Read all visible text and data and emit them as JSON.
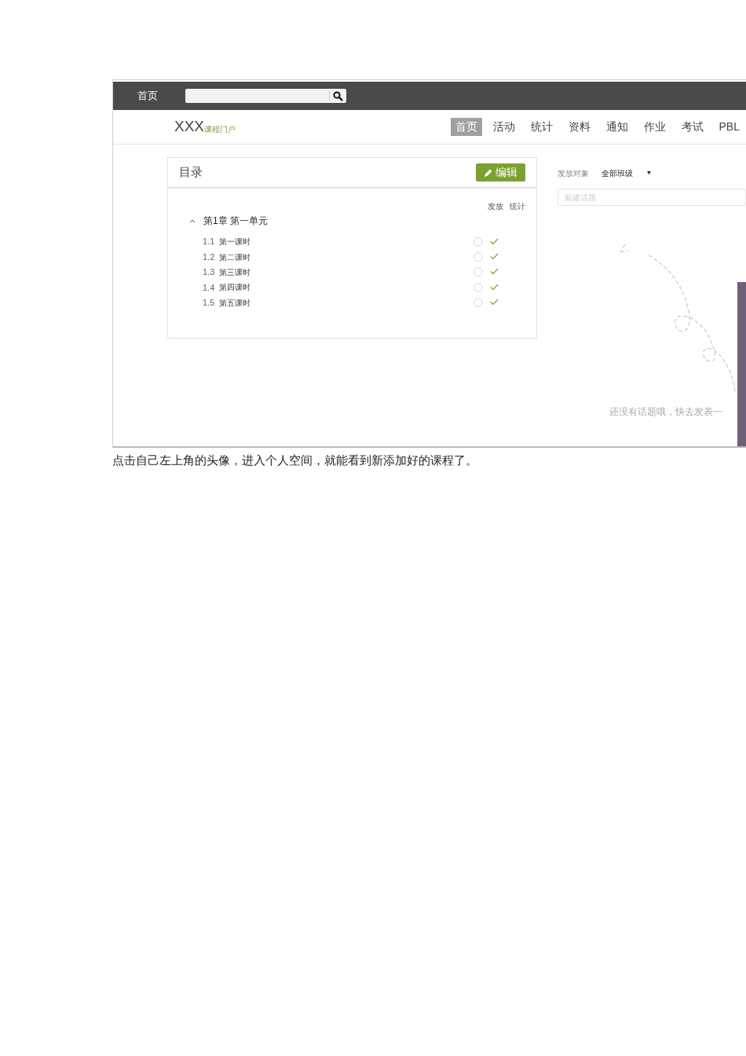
{
  "screenshot": {
    "topbar": {
      "home": "首页"
    },
    "header": {
      "logo": "XXX",
      "logo_sub": "课程门户",
      "nav": [
        {
          "label": "首页",
          "selected": true
        },
        {
          "label": "活动",
          "selected": false
        },
        {
          "label": "统计",
          "selected": false
        },
        {
          "label": "资料",
          "selected": false
        },
        {
          "label": "通知",
          "selected": false
        },
        {
          "label": "作业",
          "selected": false
        },
        {
          "label": "考试",
          "selected": false
        },
        {
          "label": "PBL",
          "selected": false
        }
      ]
    },
    "catalog": {
      "title": "目录",
      "edit_button": "编辑",
      "columns": [
        "发放",
        "统计"
      ],
      "chapters": [
        {
          "title": "第1章 第一单元",
          "expanded": true,
          "children": [
            {
              "number": "1.1",
              "title": "第一课时",
              "released": false,
              "counted": true
            },
            {
              "number": "1.2",
              "title": "第二课时",
              "released": false,
              "counted": true
            },
            {
              "number": "1.3",
              "title": "第三课时",
              "released": false,
              "counted": true
            },
            {
              "number": "1.4",
              "title": "第四课时",
              "released": false,
              "counted": true
            },
            {
              "number": "1.5",
              "title": "第五课时",
              "released": false,
              "counted": true
            }
          ]
        }
      ]
    },
    "topics": {
      "target_label": "发放对象",
      "target_value": "全部班级",
      "new_topic": {
        "placeholder": "新建话题"
      },
      "empty_text": "还没有话题哦，快去发表一"
    }
  },
  "caption": "点击自己左上角的头像，进入个人空间，就能看到新添加好的课程了。"
}
